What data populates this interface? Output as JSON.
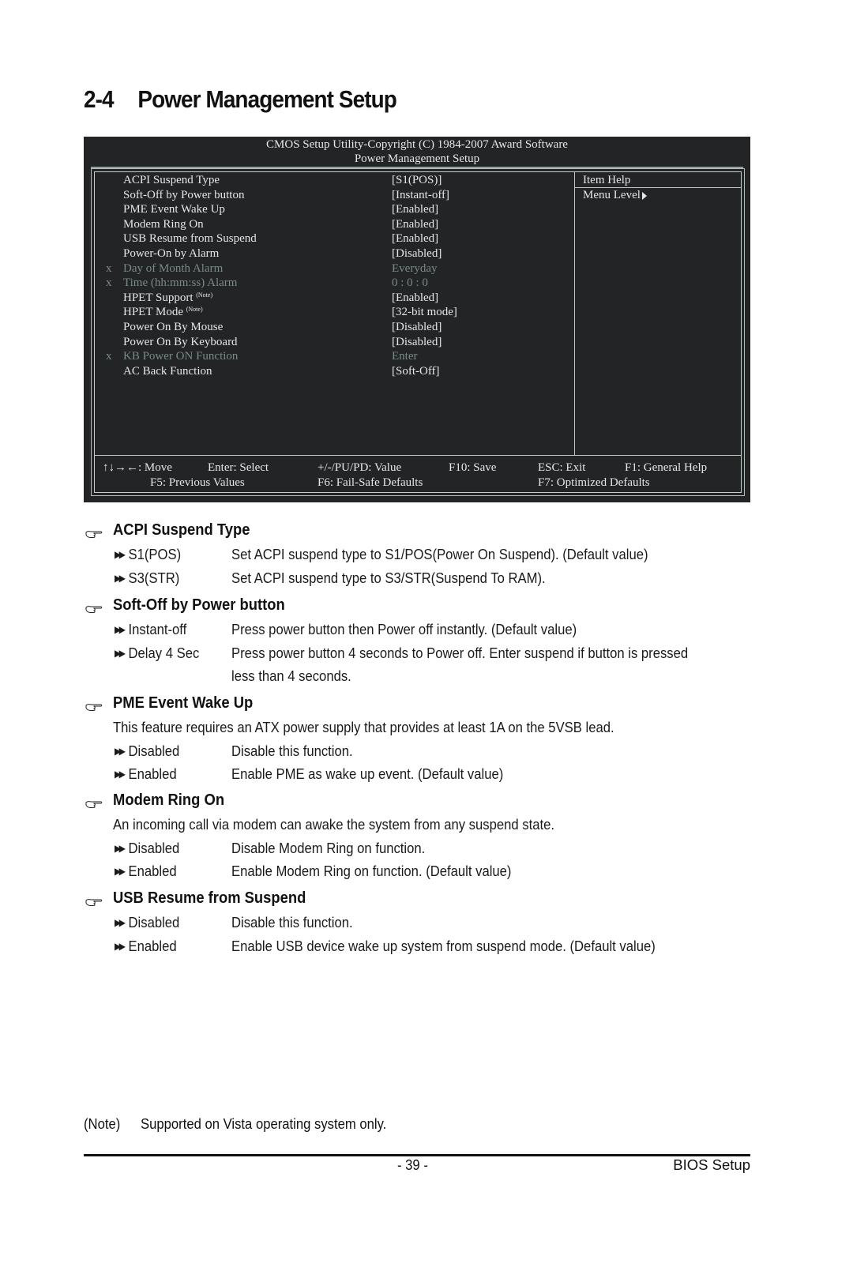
{
  "page": {
    "section_number": "2-4",
    "section_title": "Power Management Setup"
  },
  "bios": {
    "header_line1": "CMOS Setup Utility-Copyright (C) 1984-2007 Award Software",
    "header_line2": "Power Management Setup",
    "items": [
      {
        "mark": "",
        "label": "ACPI Suspend Type",
        "note": "",
        "value": "[S1(POS)]",
        "disabled": false
      },
      {
        "mark": "",
        "label": "Soft-Off by Power button",
        "note": "",
        "value": "[Instant-off]",
        "disabled": false
      },
      {
        "mark": "",
        "label": "PME Event Wake Up",
        "note": "",
        "value": "[Enabled]",
        "disabled": false
      },
      {
        "mark": "",
        "label": "Modem Ring On",
        "note": "",
        "value": "[Enabled]",
        "disabled": false
      },
      {
        "mark": "",
        "label": "USB Resume from Suspend",
        "note": "",
        "value": "[Enabled]",
        "disabled": false
      },
      {
        "mark": "",
        "label": "Power-On by Alarm",
        "note": "",
        "value": "[Disabled]",
        "disabled": false
      },
      {
        "mark": "x",
        "label": "Day of Month Alarm",
        "note": "",
        "value": "Everyday",
        "disabled": true
      },
      {
        "mark": "x",
        "label": "Time (hh:mm:ss) Alarm",
        "note": "",
        "value": "0 : 0 : 0",
        "disabled": true
      },
      {
        "mark": "",
        "label": "HPET Support",
        "note": "(Note)",
        "value": "[Enabled]",
        "disabled": false
      },
      {
        "mark": "",
        "label": "HPET Mode",
        "note": "(Note)",
        "value": "[32-bit mode]",
        "disabled": false
      },
      {
        "mark": "",
        "label": "Power On By Mouse",
        "note": "",
        "value": "[Disabled]",
        "disabled": false
      },
      {
        "mark": "",
        "label": "Power On By Keyboard",
        "note": "",
        "value": "[Disabled]",
        "disabled": false
      },
      {
        "mark": "x",
        "label": "KB Power ON Function",
        "note": "",
        "value": "Enter",
        "disabled": true
      },
      {
        "mark": "",
        "label": "AC Back Function",
        "note": "",
        "value": "[Soft-Off]",
        "disabled": false
      }
    ],
    "help_title": "Item Help",
    "help_menu_level": "Menu Level",
    "keys": {
      "move": "↑↓→←: Move",
      "select": "Enter: Select",
      "value": "+/-/PU/PD: Value",
      "save": "F10: Save",
      "exit": "ESC: Exit",
      "help": "F1: General Help",
      "previous": "F5: Previous Values",
      "failsafe": "F6: Fail-Safe Defaults",
      "optimized": "F7: Optimized Defaults"
    }
  },
  "sections": [
    {
      "title": "ACPI Suspend Type",
      "intro": "",
      "options": [
        {
          "name": "S1(POS)",
          "desc": "Set ACPI suspend type to S1/POS(Power On Suspend). (Default value)",
          "desc2": ""
        },
        {
          "name": "S3(STR)",
          "desc": "Set ACPI suspend type to S3/STR(Suspend To RAM).",
          "desc2": ""
        }
      ]
    },
    {
      "title": "Soft-Off by Power button",
      "intro": "",
      "options": [
        {
          "name": "Instant-off",
          "desc": "Press power button then Power off instantly. (Default value)",
          "desc2": ""
        },
        {
          "name": "Delay 4 Sec",
          "desc": "Press power button 4 seconds to Power off. Enter suspend if button is pressed",
          "desc2": "less than 4 seconds."
        }
      ]
    },
    {
      "title": "PME Event Wake Up",
      "intro": "This feature requires an ATX power supply that provides at least 1A on the 5VSB lead.",
      "options": [
        {
          "name": "Disabled",
          "desc": "Disable this function.",
          "desc2": ""
        },
        {
          "name": "Enabled",
          "desc": "Enable PME as wake up event. (Default value)",
          "desc2": ""
        }
      ]
    },
    {
      "title": "Modem Ring On",
      "intro": "An incoming call via modem can awake the system from any suspend state.",
      "options": [
        {
          "name": "Disabled",
          "desc": "Disable Modem Ring on function.",
          "desc2": ""
        },
        {
          "name": "Enabled",
          "desc": "Enable Modem Ring on function. (Default value)",
          "desc2": ""
        }
      ]
    },
    {
      "title": "USB Resume from Suspend",
      "intro": "",
      "options": [
        {
          "name": "Disabled",
          "desc": "Disable this function.",
          "desc2": ""
        },
        {
          "name": "Enabled",
          "desc": "Enable USB device wake up system from suspend mode. (Default value)",
          "desc2": ""
        }
      ]
    }
  ],
  "note": {
    "tag": "(Note)",
    "text": "Supported on Vista operating system only."
  },
  "footer": {
    "page_number": "- 39 -",
    "chapter": "BIOS Setup"
  }
}
